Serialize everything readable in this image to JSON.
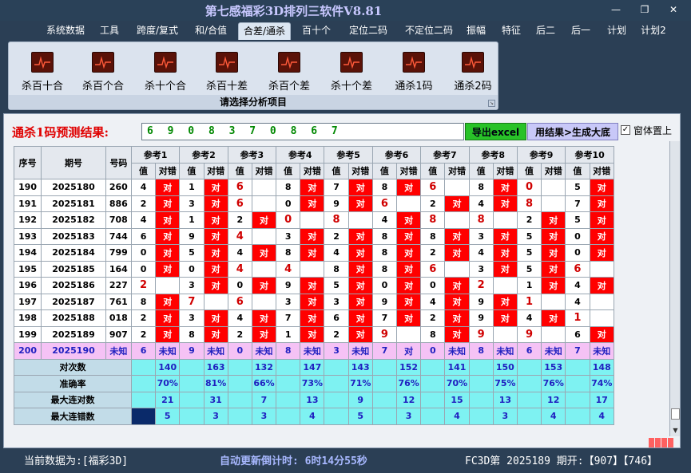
{
  "window": {
    "title": "第七感福彩3D排列三软件V8.81",
    "min": "—",
    "restore": "❐",
    "close": "✕"
  },
  "menu": [
    "系统数据",
    "工具",
    "跨度/复式",
    "和/合值",
    "合差/通杀",
    "百十个",
    "定位二码",
    "不定位二码",
    "振幅",
    "特征",
    "后二",
    "后一",
    "计划",
    "计划2"
  ],
  "menu_active": 4,
  "ribbon": {
    "buttons": [
      "杀百十合",
      "杀百个合",
      "杀十个合",
      "杀百十差",
      "杀百个差",
      "杀十个差",
      "通杀1码",
      "通杀2码"
    ],
    "caption": "请选择分析项目"
  },
  "prediction": {
    "label": "通杀1码预测结果:",
    "digits": "6 9 0 8 3 7 0 8 6 7",
    "export": "导出excel",
    "generate": "用结果>生成大底",
    "topmost": "窗体置上"
  },
  "table": {
    "headers": {
      "seq": "序号",
      "period": "期号",
      "number": "号码",
      "refs": [
        "参考1",
        "参考2",
        "参考3",
        "参考4",
        "参考5",
        "参考6",
        "参考7",
        "参考8",
        "参考9",
        "参考10"
      ],
      "val": "值",
      "res": "对错"
    },
    "rows": [
      {
        "seq": "190",
        "period": "2025180",
        "num": "260",
        "cells": [
          [
            "4",
            "对"
          ],
          [
            "1",
            "对"
          ],
          [
            "6",
            ""
          ],
          [
            "8",
            "对"
          ],
          [
            "7",
            "对"
          ],
          [
            "8",
            "对"
          ],
          [
            "6",
            ""
          ],
          [
            "8",
            "对"
          ],
          [
            "0",
            ""
          ],
          [
            "5",
            "对"
          ]
        ]
      },
      {
        "seq": "191",
        "period": "2025181",
        "num": "886",
        "cells": [
          [
            "2",
            "对"
          ],
          [
            "3",
            "对"
          ],
          [
            "6",
            ""
          ],
          [
            "0",
            "对"
          ],
          [
            "9",
            "对"
          ],
          [
            "6",
            ""
          ],
          [
            "2",
            "对"
          ],
          [
            "4",
            "对"
          ],
          [
            "8",
            ""
          ],
          [
            "7",
            "对"
          ]
        ]
      },
      {
        "seq": "192",
        "period": "2025182",
        "num": "708",
        "cells": [
          [
            "4",
            "对"
          ],
          [
            "1",
            "对"
          ],
          [
            "2",
            "对"
          ],
          [
            "0",
            ""
          ],
          [
            "8",
            ""
          ],
          [
            "4",
            "对"
          ],
          [
            "8",
            ""
          ],
          [
            "8",
            ""
          ],
          [
            "2",
            "对"
          ],
          [
            "5",
            "对"
          ]
        ]
      },
      {
        "seq": "193",
        "period": "2025183",
        "num": "744",
        "cells": [
          [
            "6",
            "对"
          ],
          [
            "9",
            "对"
          ],
          [
            "4",
            ""
          ],
          [
            "3",
            "对"
          ],
          [
            "2",
            "对"
          ],
          [
            "8",
            "对"
          ],
          [
            "8",
            "对"
          ],
          [
            "3",
            "对"
          ],
          [
            "5",
            "对"
          ],
          [
            "0",
            "对"
          ]
        ]
      },
      {
        "seq": "194",
        "period": "2025184",
        "num": "799",
        "cells": [
          [
            "0",
            "对"
          ],
          [
            "5",
            "对"
          ],
          [
            "4",
            "对"
          ],
          [
            "8",
            "对"
          ],
          [
            "4",
            "对"
          ],
          [
            "8",
            "对"
          ],
          [
            "2",
            "对"
          ],
          [
            "4",
            "对"
          ],
          [
            "5",
            "对"
          ],
          [
            "0",
            "对"
          ]
        ]
      },
      {
        "seq": "195",
        "period": "2025185",
        "num": "164",
        "cells": [
          [
            "0",
            "对"
          ],
          [
            "0",
            "对"
          ],
          [
            "4",
            ""
          ],
          [
            "4",
            ""
          ],
          [
            "8",
            "对"
          ],
          [
            "8",
            "对"
          ],
          [
            "6",
            ""
          ],
          [
            "3",
            "对"
          ],
          [
            "5",
            "对"
          ],
          [
            "6",
            ""
          ]
        ]
      },
      {
        "seq": "196",
        "period": "2025186",
        "num": "227",
        "cells": [
          [
            "2",
            ""
          ],
          [
            "3",
            "对"
          ],
          [
            "0",
            "对"
          ],
          [
            "9",
            "对"
          ],
          [
            "5",
            "对"
          ],
          [
            "0",
            "对"
          ],
          [
            "0",
            "对"
          ],
          [
            "2",
            ""
          ],
          [
            "1",
            "对"
          ],
          [
            "4",
            "对"
          ]
        ]
      },
      {
        "seq": "197",
        "period": "2025187",
        "num": "761",
        "cells": [
          [
            "8",
            "对"
          ],
          [
            "7",
            ""
          ],
          [
            "6",
            ""
          ],
          [
            "3",
            "对"
          ],
          [
            "3",
            "对"
          ],
          [
            "9",
            "对"
          ],
          [
            "4",
            "对"
          ],
          [
            "9",
            "对"
          ],
          [
            "1",
            ""
          ],
          [
            "4",
            ""
          ]
        ]
      },
      {
        "seq": "198",
        "period": "2025188",
        "num": "018",
        "cells": [
          [
            "2",
            "对"
          ],
          [
            "3",
            "对"
          ],
          [
            "4",
            "对"
          ],
          [
            "7",
            "对"
          ],
          [
            "6",
            "对"
          ],
          [
            "7",
            "对"
          ],
          [
            "2",
            "对"
          ],
          [
            "9",
            "对"
          ],
          [
            "4",
            "对"
          ],
          [
            "1",
            ""
          ]
        ]
      },
      {
        "seq": "199",
        "period": "2025189",
        "num": "907",
        "cells": [
          [
            "2",
            "对"
          ],
          [
            "8",
            "对"
          ],
          [
            "2",
            "对"
          ],
          [
            "1",
            "对"
          ],
          [
            "2",
            "对"
          ],
          [
            "9",
            ""
          ],
          [
            "8",
            "对"
          ],
          [
            "9",
            ""
          ],
          [
            "9",
            ""
          ],
          [
            "6",
            "对"
          ]
        ]
      },
      {
        "seq": "200",
        "period": "2025190",
        "num": "未知",
        "cells": [
          [
            "6",
            "未知"
          ],
          [
            "9",
            "未知"
          ],
          [
            "0",
            "未知"
          ],
          [
            "8",
            "未知"
          ],
          [
            "3",
            "未知"
          ],
          [
            "7",
            "对"
          ],
          [
            "0",
            "未知"
          ],
          [
            "8",
            "未知"
          ],
          [
            "6",
            "未知"
          ],
          [
            "7",
            "未知"
          ]
        ]
      }
    ],
    "stats": [
      {
        "label": "对次数",
        "values": [
          "140",
          "163",
          "132",
          "147",
          "143",
          "152",
          "141",
          "150",
          "153",
          "148"
        ]
      },
      {
        "label": "准确率",
        "values": [
          "70%",
          "81%",
          "66%",
          "73%",
          "71%",
          "76%",
          "70%",
          "75%",
          "76%",
          "74%"
        ]
      },
      {
        "label": "最大连对数",
        "values": [
          "21",
          "31",
          "7",
          "13",
          "9",
          "12",
          "15",
          "13",
          "12",
          "17"
        ]
      },
      {
        "label": "最大连错数",
        "values": [
          "5",
          "3",
          "3",
          "4",
          "5",
          "3",
          "4",
          "3",
          "4",
          "4"
        ]
      }
    ]
  },
  "status": {
    "current": "当前数据为:[福彩3D]",
    "countdown": "自动更新倒计时: 6时14分55秒",
    "draw": "FC3D第 2025189 期开:【907】【746】"
  }
}
